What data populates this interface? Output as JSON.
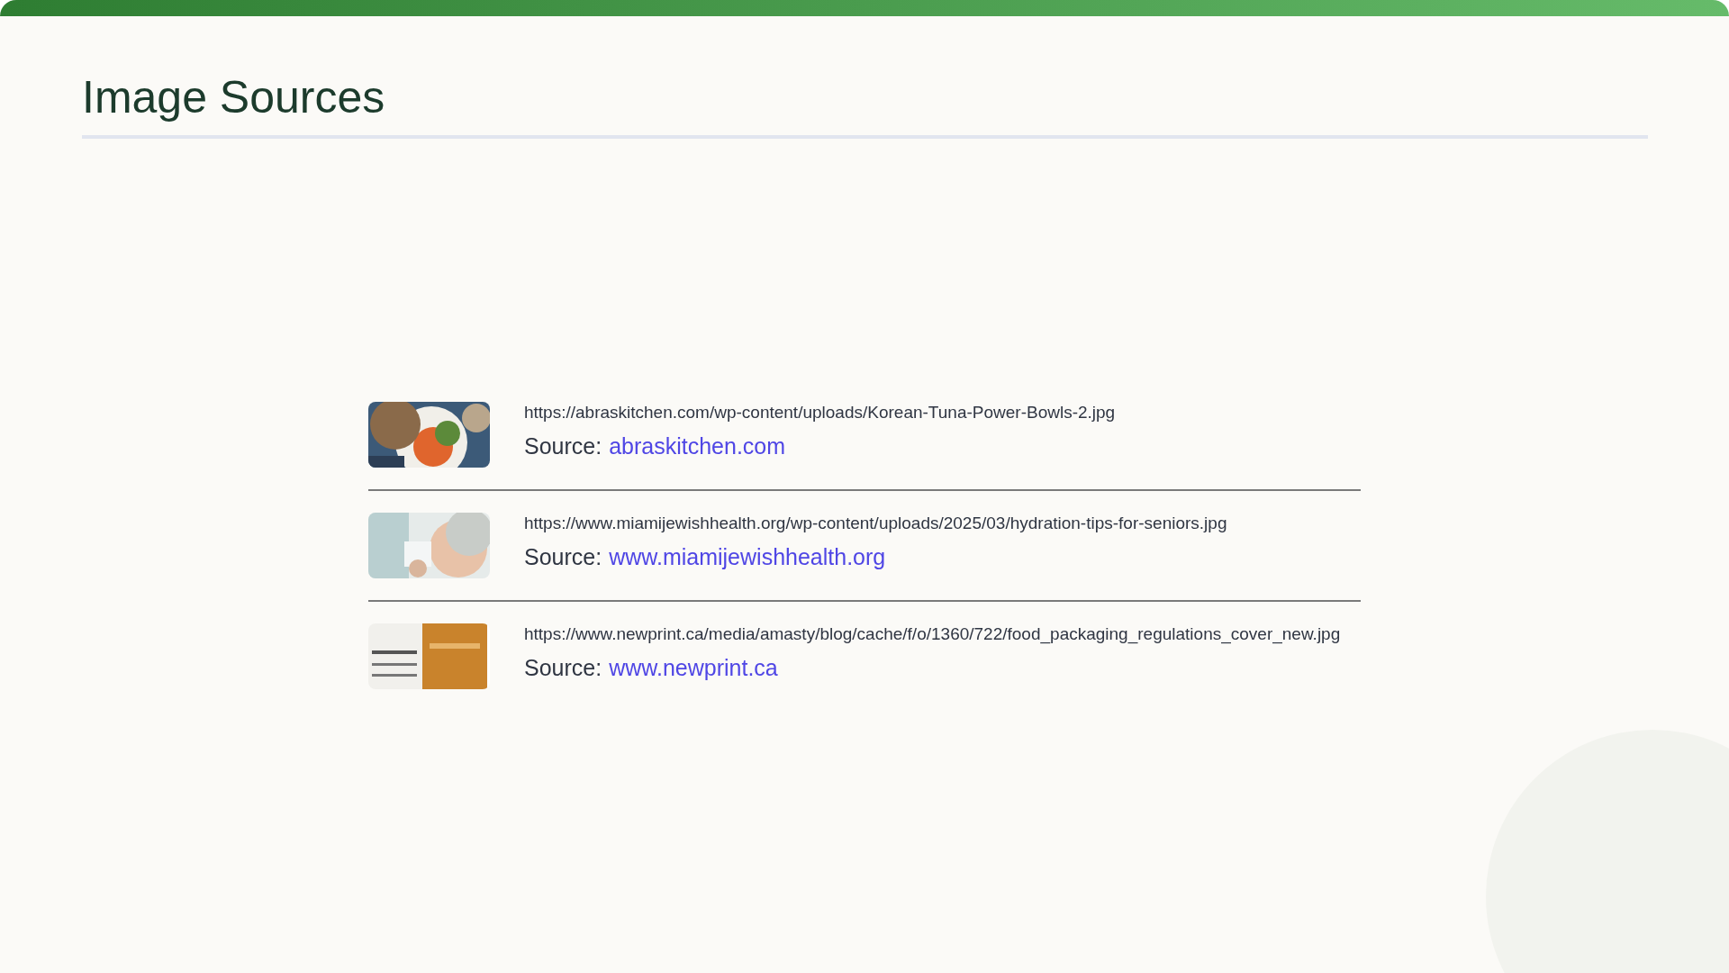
{
  "title": "Image Sources",
  "sources": [
    {
      "url": "https://abraskitchen.com/wp-content/uploads/Korean-Tuna-Power-Bowls-2.jpg",
      "label": "Source:",
      "link": "abraskitchen.com"
    },
    {
      "url": "https://www.miamijewishhealth.org/wp-content/uploads/2025/03/hydration-tips-for-seniors.jpg",
      "label": "Source:",
      "link": "www.miamijewishhealth.org"
    },
    {
      "url": "https://www.newprint.ca/media/amasty/blog/cache/f/o/1360/722/food_packaging_regulations_cover_new.jpg",
      "label": "Source:",
      "link": "www.newprint.ca"
    }
  ]
}
